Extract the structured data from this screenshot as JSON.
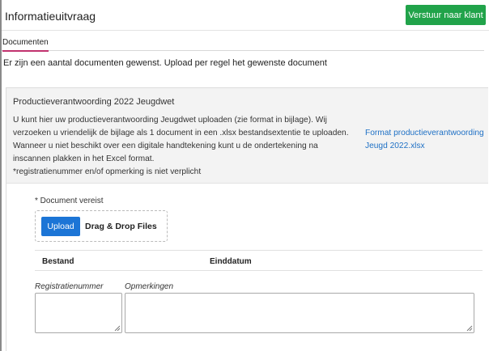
{
  "header": {
    "title": "Informatieuitvraag",
    "send_button": "Verstuur naar klant"
  },
  "tabs": [
    {
      "label": "Documenten",
      "active": true
    }
  ],
  "intro": "Er zijn een aantal documenten gewenst. Upload per regel het gewenste document",
  "document": {
    "title": "Productieverantwoording 2022 Jeugdwet",
    "description_lines": [
      "U kunt hier uw productieverantwoording Jeugdwet uploaden (zie format in bijlage). Wij",
      "verzoeken u vriendelijk de bijlage als 1 document in een .xlsx bestandsextentie te uploaden.",
      "Wanneer u niet beschikt over een digitale handtekening kunt u de ondertekening na",
      "inscannen plakken in het Excel format.",
      "*registratienummer en/of opmerking is niet verplicht"
    ],
    "format_link": "Format productieverantwoording Jeugd 2022.xlsx",
    "required_label": "* Document vereist",
    "upload_button": "Upload",
    "drag_drop_label": "Drag & Drop Files",
    "table_headers": [
      "Bestand",
      "Einddatum"
    ],
    "registration_label": "Registratienummer",
    "remarks_label": "Opmerkingen",
    "registration_value": "",
    "remarks_value": ""
  },
  "colors": {
    "send_button": "#21a34a",
    "upload_button": "#1c75d6",
    "tab_underline": "#c1326e",
    "link": "#1e70c5",
    "card_header_bg": "#f3f3f3"
  }
}
